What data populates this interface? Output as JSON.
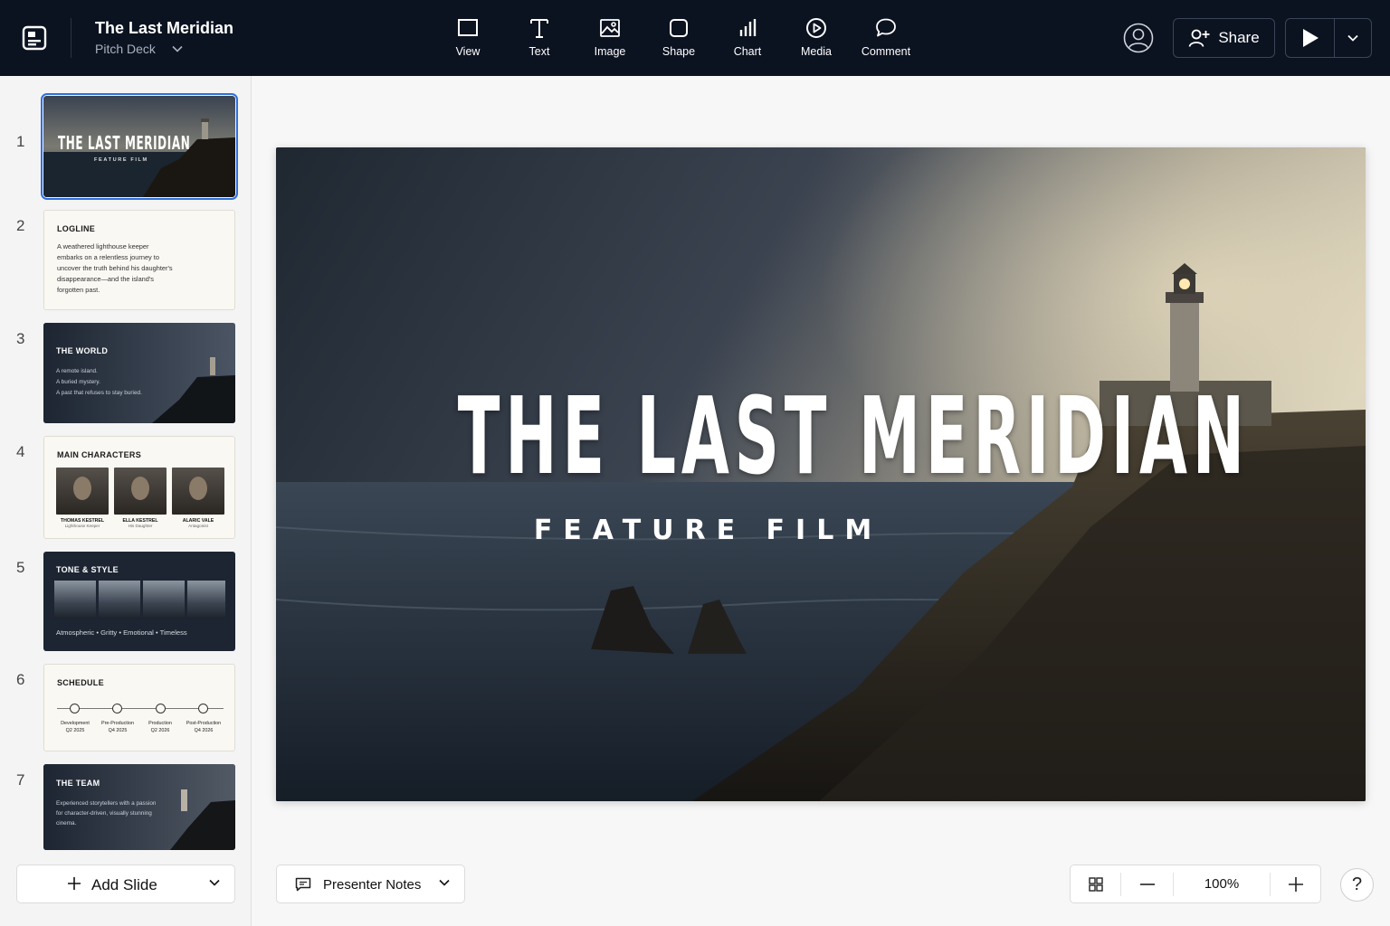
{
  "header": {
    "title": "The Last Meridian",
    "subtitle": "Pitch Deck",
    "tools": [
      {
        "label": "View",
        "icon": "rectangle-icon"
      },
      {
        "label": "Text",
        "icon": "text-icon"
      },
      {
        "label": "Image",
        "icon": "image-icon"
      },
      {
        "label": "Shape",
        "icon": "shape-icon"
      },
      {
        "label": "Chart",
        "icon": "bar-chart-icon"
      },
      {
        "label": "Media",
        "icon": "play-circle-icon"
      },
      {
        "label": "Comment",
        "icon": "comment-icon"
      }
    ],
    "share_label": "Share"
  },
  "slides": [
    {
      "num": "1",
      "title": "THE LAST MERIDIAN",
      "subtitle": "FEATURE FILM"
    },
    {
      "num": "2",
      "title": "LOGLINE",
      "lines": [
        "A weathered lighthouse keeper",
        "embarks on a relentless journey to",
        "uncover the truth behind his daughter's",
        "disappearance—and the island's",
        "forgotten past."
      ]
    },
    {
      "num": "3",
      "title": "THE WORLD",
      "lines": [
        "A remote island.",
        "A buried mystery.",
        "A past that refuses to stay buried."
      ]
    },
    {
      "num": "4",
      "title": "MAIN CHARACTERS",
      "characters": [
        {
          "name": "THOMAS KESTREL",
          "role": "Lighthouse Keeper"
        },
        {
          "name": "ELLA KESTREL",
          "role": "His Daughter"
        },
        {
          "name": "ALARIC VALE",
          "role": "Antagonist"
        }
      ]
    },
    {
      "num": "5",
      "title": "TONE & STYLE",
      "tags": "Atmospheric  •  Gritty  •  Emotional  •  Timeless"
    },
    {
      "num": "6",
      "title": "SCHEDULE",
      "milestones": [
        {
          "phase": "Development",
          "date": "Q2 2025"
        },
        {
          "phase": "Pre-Production",
          "date": "Q4 2025"
        },
        {
          "phase": "Production",
          "date": "Q2 2026"
        },
        {
          "phase": "Post-Production",
          "date": "Q4 2026"
        }
      ]
    },
    {
      "num": "7",
      "title": "THE TEAM",
      "lines": [
        "Experienced storytellers with a passion",
        "for character-driven, visually stunning",
        "cinema."
      ]
    }
  ],
  "sidebar": {
    "add_slide_label": "Add Slide"
  },
  "canvas": {
    "title": "THE LAST MERIDIAN",
    "subtitle": "FEATURE FILM"
  },
  "footer": {
    "notes_label": "Presenter Notes",
    "zoom": "100%",
    "help": "?"
  },
  "colors": {
    "topbar": "#0b1220",
    "selection": "#2f6fe0",
    "thumb_dark": "#1d2532",
    "thumb_light": "#faf8f3"
  }
}
